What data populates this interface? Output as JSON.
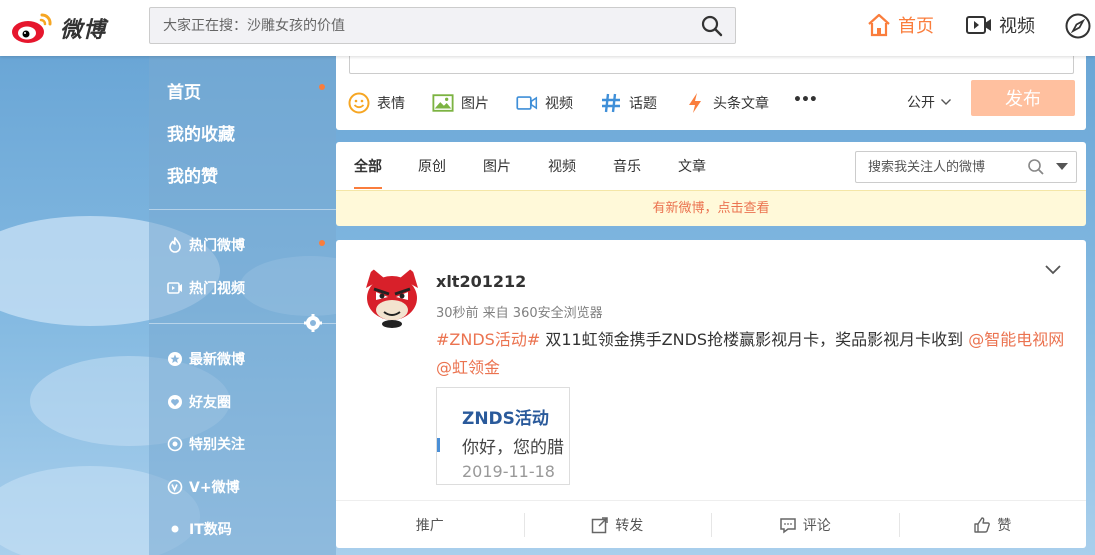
{
  "header": {
    "logo_text": "微博",
    "search_placeholder": "大家正在搜：沙雕女孩的价值",
    "nav_home": "首页",
    "nav_video": "视频"
  },
  "sidebar": {
    "top_items": [
      "首页",
      "我的收藏",
      "我的赞"
    ],
    "groups": [
      {
        "label": "热门微博",
        "icon": "fire-icon"
      },
      {
        "label": "热门视频",
        "icon": "video-icon"
      }
    ],
    "feeds": [
      {
        "label": "最新微博",
        "icon": "star-icon"
      },
      {
        "label": "好友圈",
        "icon": "heart-icon"
      },
      {
        "label": "特别关注",
        "icon": "eye-icon"
      },
      {
        "label": "V+微博",
        "icon": "vplus-icon"
      },
      {
        "label": "IT数码",
        "icon": "bullet-icon"
      }
    ]
  },
  "publish": {
    "tools": [
      {
        "label": "表情",
        "icon": "emoji-icon",
        "color": "#f6a623"
      },
      {
        "label": "图片",
        "icon": "image-icon",
        "color": "#7cb342"
      },
      {
        "label": "视频",
        "icon": "video-icon",
        "color": "#3f8fd8"
      },
      {
        "label": "话题",
        "icon": "hashtag-icon",
        "color": "#3f8fd8"
      },
      {
        "label": "头条文章",
        "icon": "lightning-icon",
        "color": "#fa7d3c"
      }
    ],
    "more": "•••",
    "visibility": "公开",
    "submit": "发布"
  },
  "filter": {
    "tabs": [
      "全部",
      "原创",
      "图片",
      "视频",
      "音乐",
      "文章"
    ],
    "active": "全部",
    "search_placeholder": "搜索我关注人的微博"
  },
  "new_notice": "有新微博，点击查看",
  "post": {
    "username": "xlt201212",
    "meta": "30秒前 来自 360安全浏览器",
    "topic": "#ZNDS活动#",
    "text": " 双11虹领金携手ZNDS抢楼赢影视月卡，奖品影视月卡收到 ",
    "mention1": "@智能电视网",
    "mention2": "@虹领金",
    "thumb": {
      "title": "ZNDS活动",
      "line": "你好，您的腊",
      "date": "2019-11-18"
    },
    "actions": [
      {
        "label": "推广",
        "icon": ""
      },
      {
        "label": "转发",
        "icon": "share-icon"
      },
      {
        "label": "评论",
        "icon": "comment-icon"
      },
      {
        "label": "赞",
        "icon": "like-icon"
      }
    ]
  },
  "colors": {
    "accent": "#fa7d3c",
    "link": "#eb7350",
    "publish_disabled": "#ffc09f",
    "notice_bg": "#fff9d9"
  }
}
